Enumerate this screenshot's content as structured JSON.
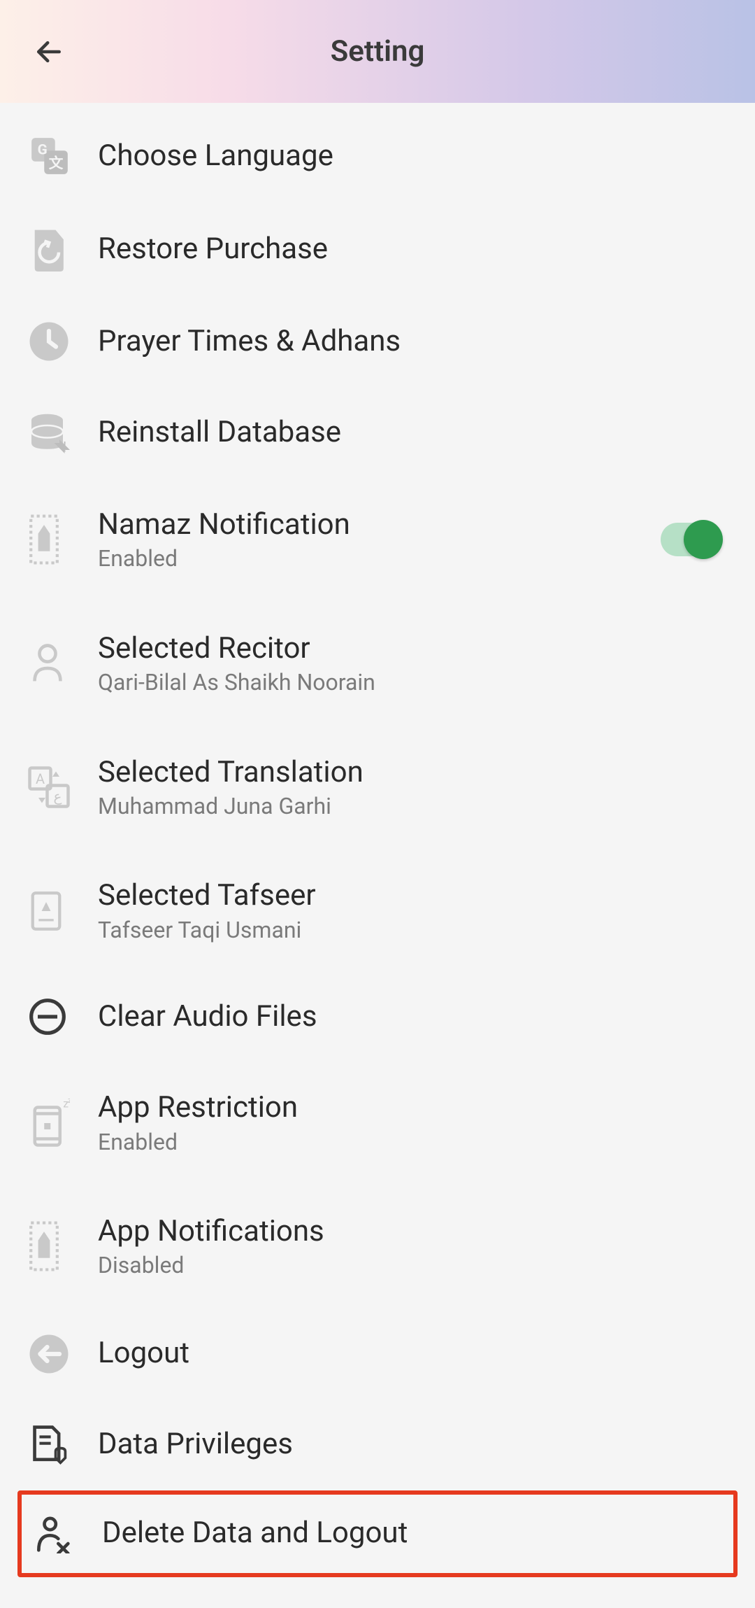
{
  "header": {
    "title": "Setting"
  },
  "items": {
    "choose_language": {
      "label": "Choose Language"
    },
    "restore_purchase": {
      "label": "Restore Purchase"
    },
    "prayer_times": {
      "label": "Prayer Times & Adhans"
    },
    "reinstall_db": {
      "label": "Reinstall Database"
    },
    "namaz_notification": {
      "label": "Namaz Notification",
      "sub": "Enabled",
      "toggle": true
    },
    "selected_recitor": {
      "label": "Selected Recitor",
      "sub": "Qari-Bilal As Shaikh Noorain"
    },
    "selected_translation": {
      "label": "Selected Translation",
      "sub": "Muhammad Juna Garhi"
    },
    "selected_tafseer": {
      "label": "Selected Tafseer",
      "sub": "Tafseer Taqi Usmani"
    },
    "clear_audio": {
      "label": "Clear Audio Files"
    },
    "app_restriction": {
      "label": "App Restriction",
      "sub": "Enabled"
    },
    "app_notifications": {
      "label": "App Notifications",
      "sub": "Disabled"
    },
    "logout": {
      "label": "Logout"
    },
    "data_privileges": {
      "label": "Data Privileges"
    },
    "delete_logout": {
      "label": "Delete Data and Logout"
    }
  }
}
